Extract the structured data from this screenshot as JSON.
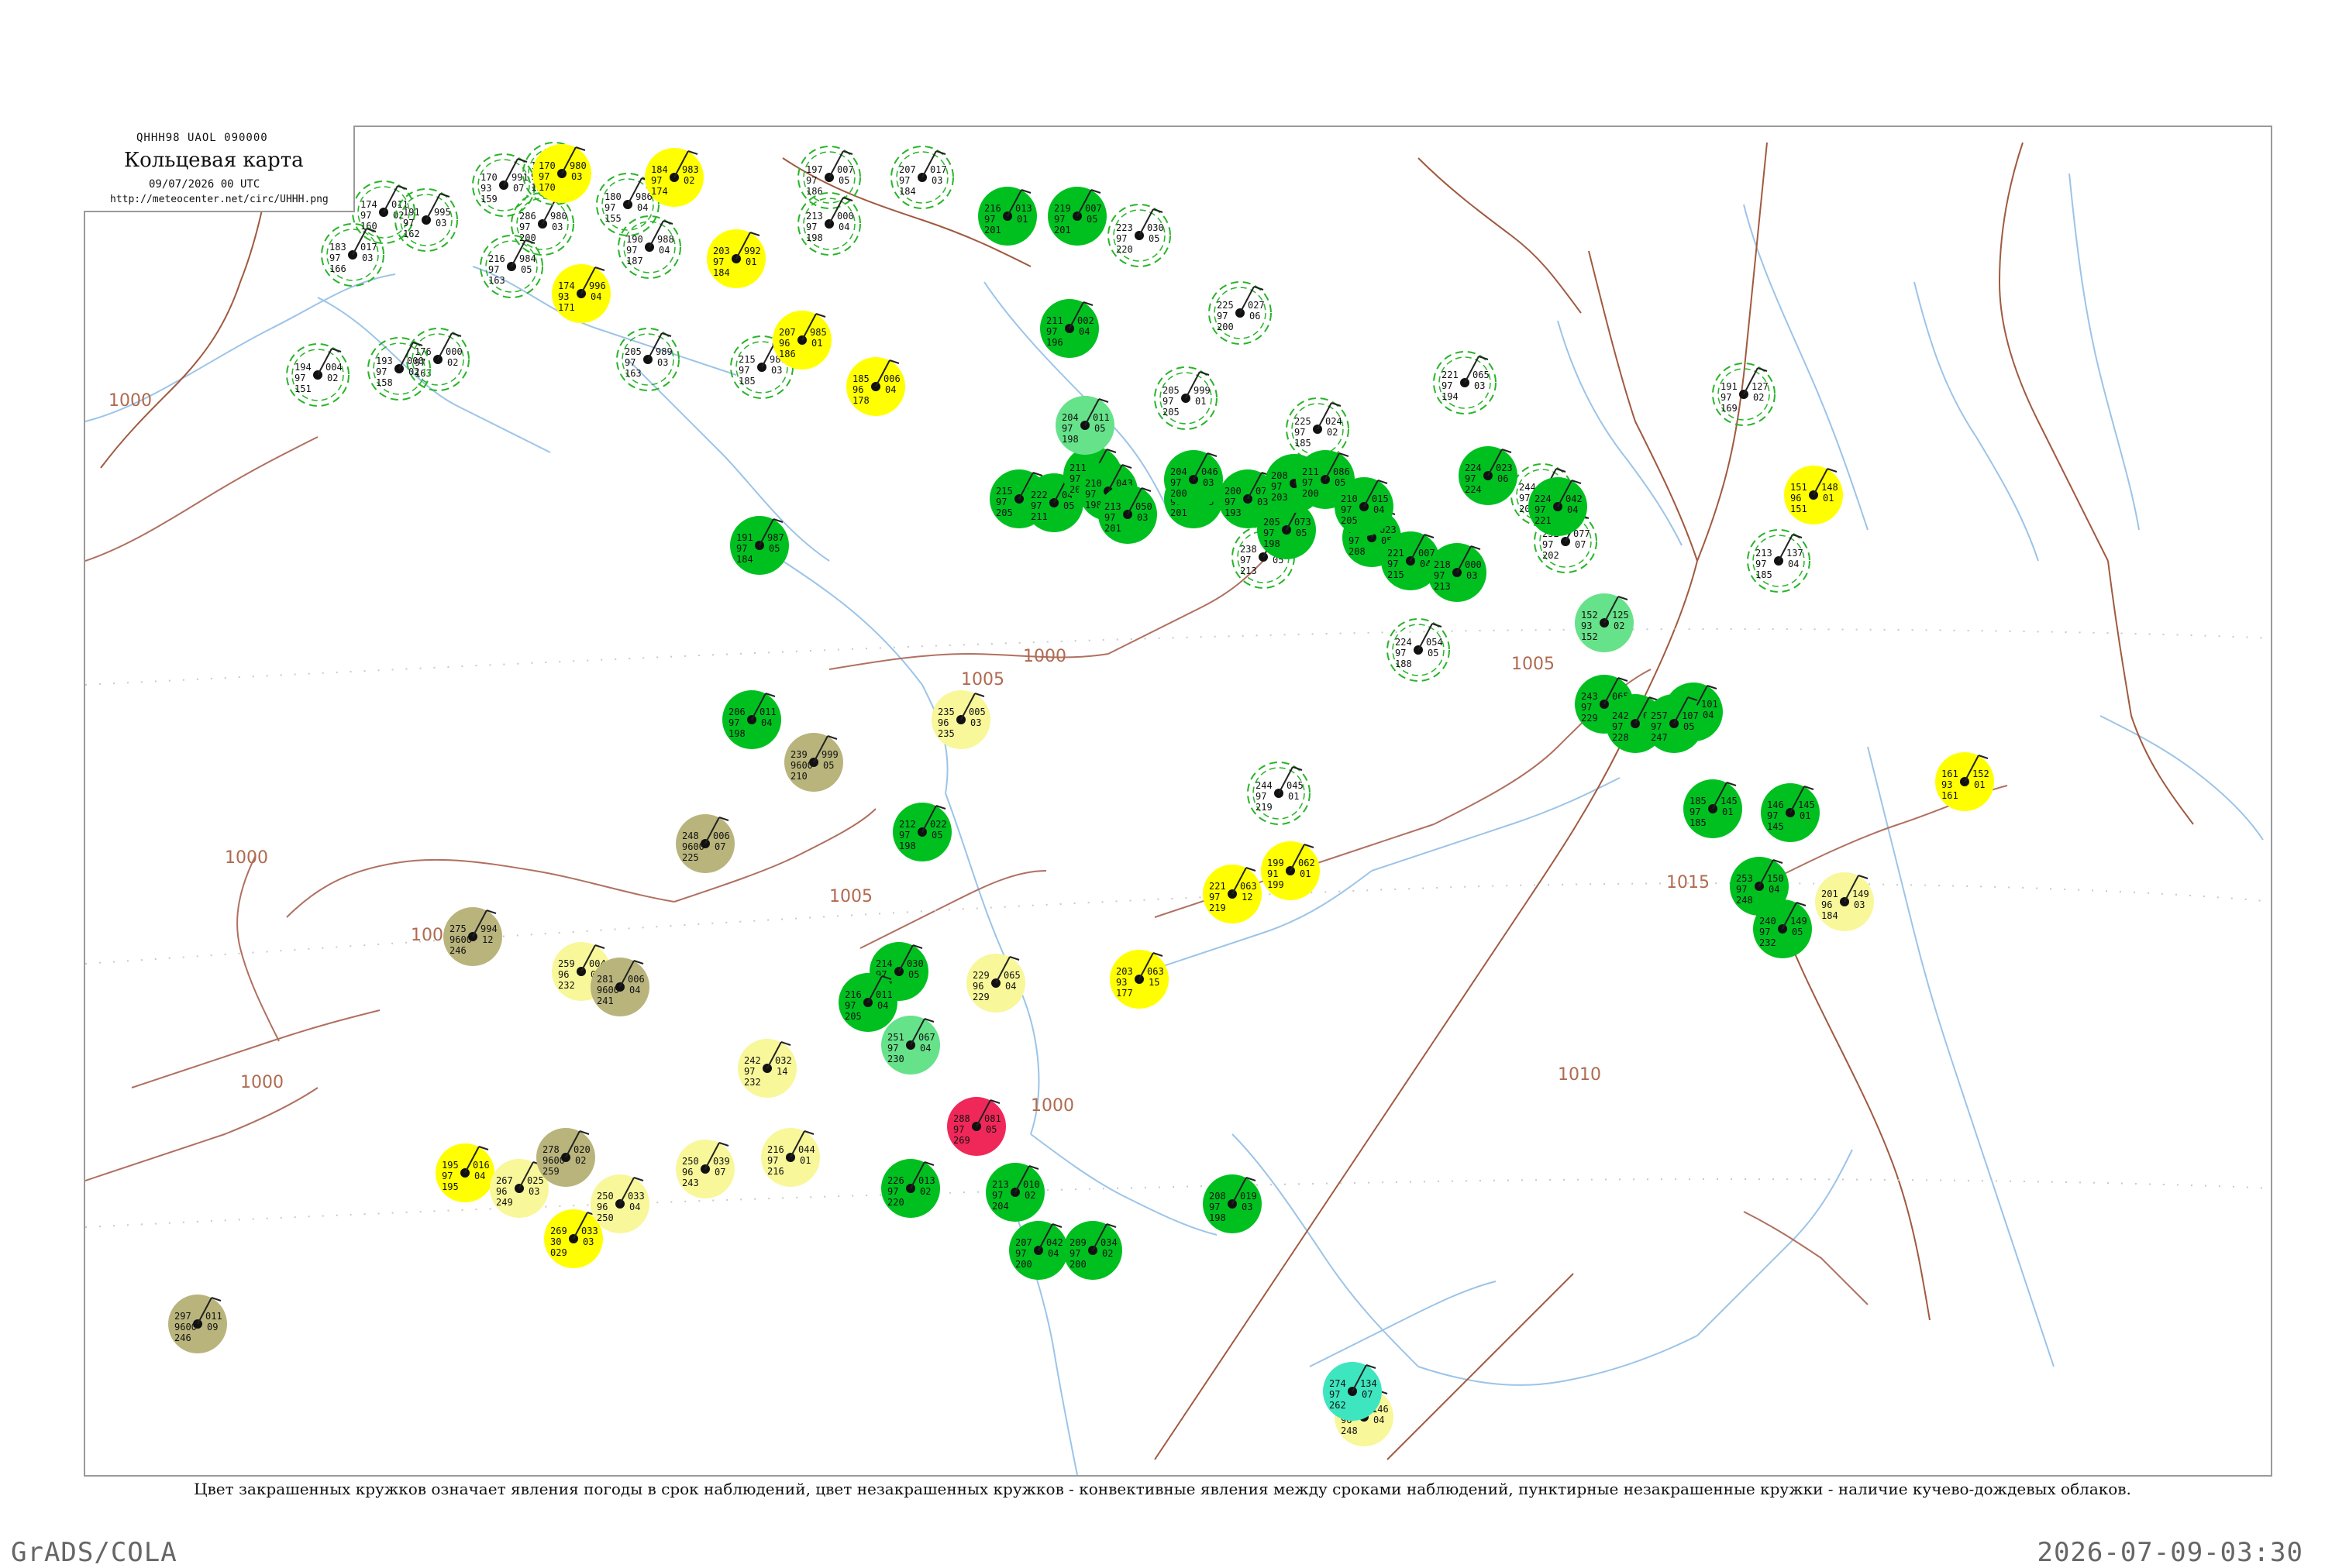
{
  "header": {
    "codes": "QHHH98  UAOL  090000",
    "title": "Кольцевая карта",
    "datetime": "09/07/2026 00 UTC",
    "url": "http://meteocenter.net/circ/UHHH.png"
  },
  "caption": "Цвет закрашенных кружков означает явления погоды в срок наблюдений, цвет незакрашенных кружков - конвективные явления между сроками наблюдений, пунктирные незакрашенные кружки - наличие кучево-дождевых облаков.",
  "footer": {
    "left": "GrADS/COLA",
    "right": "2026-07-09-03:30"
  },
  "colors": {
    "rain_green": "#00c020",
    "shower_green": "#00b428",
    "light_green": "#66e28a",
    "cyan": "#3ee6c0",
    "yellow": "#ffff00",
    "pale_yellow": "#f8f79a",
    "olive": "#b8b47c",
    "thunder_red": "#f0285a",
    "outline_green": "#28b428",
    "isobar": "#a05a40",
    "river": "#9cc4e8"
  },
  "isobars": [
    "1000",
    "1000",
    "1000",
    "1000",
    "1005",
    "1005",
    "1005",
    "1010",
    "1015",
    "1000",
    "1000"
  ],
  "stations": [
    {
      "kind": "outline",
      "a": "170",
      "b": "93",
      "c": "159",
      "d": "991",
      "e": "07"
    },
    {
      "kind": "outline",
      "a": "286",
      "b": "97",
      "c": "200",
      "d": "980",
      "e": "03"
    },
    {
      "kind": "outline",
      "a": "180",
      "b": "97",
      "c": "155",
      "d": "986",
      "e": "04"
    },
    {
      "kind": "outline",
      "a": "170",
      "b": "97",
      "c": "150",
      "d": "980",
      "e": "06"
    },
    {
      "kind": "outline",
      "a": "174",
      "b": "97",
      "c": "160",
      "d": "011",
      "e": "02"
    },
    {
      "kind": "outline",
      "a": "191",
      "b": "97",
      "c": "162",
      "d": "995",
      "e": "03"
    },
    {
      "kind": "outline",
      "a": "183",
      "b": "97",
      "c": "166",
      "d": "017",
      "e": "03"
    },
    {
      "kind": "outline",
      "a": "190",
      "b": "97",
      "c": "187",
      "d": "988",
      "e": "04"
    },
    {
      "kind": "outline",
      "a": "216",
      "b": "97",
      "c": "163",
      "d": "984",
      "e": "05"
    },
    {
      "kind": "outline",
      "a": "176",
      "b": "97",
      "c": "163",
      "d": "000",
      "e": "02"
    },
    {
      "kind": "outline",
      "a": "205",
      "b": "97",
      "c": "163",
      "d": "989",
      "e": "03"
    },
    {
      "kind": "outline",
      "a": "194",
      "b": "97",
      "c": "151",
      "d": "004",
      "e": "02"
    },
    {
      "kind": "outline",
      "a": "193",
      "b": "97",
      "c": "158",
      "d": "000",
      "e": "02"
    },
    {
      "kind": "outline",
      "a": "215",
      "b": "97",
      "c": "185",
      "d": "987",
      "e": "03"
    },
    {
      "kind": "outline",
      "a": "197",
      "b": "97",
      "c": "186",
      "d": "007",
      "e": "05"
    },
    {
      "kind": "outline",
      "a": "213",
      "b": "97",
      "c": "198",
      "d": "000",
      "e": "04"
    },
    {
      "kind": "outline",
      "a": "207",
      "b": "97",
      "c": "184",
      "d": "017",
      "e": "03"
    },
    {
      "kind": "outline",
      "a": "223",
      "b": "97",
      "c": "220",
      "d": "030",
      "e": "05"
    },
    {
      "kind": "outline",
      "a": "225",
      "b": "97",
      "c": "200",
      "d": "027",
      "e": "06"
    },
    {
      "kind": "outline",
      "a": "205",
      "b": "97",
      "c": "205",
      "d": "999",
      "e": "01"
    },
    {
      "kind": "outline",
      "a": "238",
      "b": "97",
      "c": "213",
      "d": "007",
      "e": "05"
    },
    {
      "kind": "outline",
      "a": "224",
      "b": "97",
      "c": "188",
      "d": "054",
      "e": "05"
    },
    {
      "kind": "outline",
      "a": "221",
      "b": "97",
      "c": "194",
      "d": "065",
      "e": "03"
    },
    {
      "kind": "outline",
      "a": "244",
      "b": "97",
      "c": "205",
      "d": "060",
      "e": "01"
    },
    {
      "kind": "outline",
      "a": "232",
      "b": "97",
      "c": "202",
      "d": "077",
      "e": "07"
    },
    {
      "kind": "outline",
      "a": "191",
      "b": "97",
      "c": "169",
      "d": "127",
      "e": "02"
    },
    {
      "kind": "outline",
      "a": "213",
      "b": "97",
      "c": "185",
      "d": "137",
      "e": "04"
    },
    {
      "kind": "outline",
      "a": "244",
      "b": "97",
      "c": "219",
      "d": "045",
      "e": "01"
    },
    {
      "kind": "outline",
      "a": "225",
      "b": "97",
      "c": "185",
      "d": "024",
      "e": "02"
    },
    {
      "kind": "yellow",
      "a": "170",
      "b": "97",
      "c": "170",
      "d": "980",
      "e": "03"
    },
    {
      "kind": "yellow",
      "a": "184",
      "b": "97",
      "c": "174",
      "d": "983",
      "e": "02"
    },
    {
      "kind": "yellow",
      "a": "203",
      "b": "97",
      "c": "184",
      "d": "992",
      "e": "01"
    },
    {
      "kind": "yellow",
      "a": "174",
      "b": "93",
      "c": "171",
      "d": "996",
      "e": "04"
    },
    {
      "kind": "yellow",
      "a": "207",
      "b": "96",
      "c": "186",
      "d": "985",
      "e": "01"
    },
    {
      "kind": "yellow",
      "a": "185",
      "b": "96",
      "c": "178",
      "d": "006",
      "e": "04"
    },
    {
      "kind": "yellow",
      "a": "221",
      "b": "97",
      "c": "219",
      "d": "063",
      "e": "12"
    },
    {
      "kind": "yellow",
      "a": "199",
      "b": "91",
      "c": "199",
      "d": "062",
      "e": "01"
    },
    {
      "kind": "yellow",
      "a": "203",
      "b": "93",
      "c": "177",
      "d": "063",
      "e": "15"
    },
    {
      "kind": "yellow",
      "a": "151",
      "b": "96",
      "c": "151",
      "d": "148",
      "e": "01"
    },
    {
      "kind": "yellow",
      "a": "161",
      "b": "93",
      "c": "161",
      "d": "152",
      "e": "01"
    },
    {
      "kind": "yellow",
      "a": "195",
      "b": "97",
      "c": "195",
      "d": "016",
      "e": "04"
    },
    {
      "kind": "yellow",
      "a": "269",
      "b": "30",
      "c": "029",
      "d": "033",
      "e": "03"
    },
    {
      "kind": "pale",
      "a": "235",
      "b": "96",
      "c": "235",
      "d": "005",
      "e": "03"
    },
    {
      "kind": "pale",
      "a": "229",
      "b": "96",
      "c": "229",
      "d": "065",
      "e": "04"
    },
    {
      "kind": "pale",
      "a": "242",
      "b": "97",
      "c": "232",
      "d": "032",
      "e": "14"
    },
    {
      "kind": "pale",
      "a": "259",
      "b": "96",
      "c": "232",
      "d": "004",
      "e": "05"
    },
    {
      "kind": "pale",
      "a": "250",
      "b": "96",
      "c": "243",
      "d": "039",
      "e": "07"
    },
    {
      "kind": "pale",
      "a": "216",
      "b": "97",
      "c": "216",
      "d": "044",
      "e": "01"
    },
    {
      "kind": "pale",
      "a": "267",
      "b": "96",
      "c": "249",
      "d": "025",
      "e": "03"
    },
    {
      "kind": "pale",
      "a": "250",
      "b": "96",
      "c": "250",
      "d": "033",
      "e": "04"
    },
    {
      "kind": "pale",
      "a": "201",
      "b": "96",
      "c": "184",
      "d": "149",
      "e": "03"
    },
    {
      "kind": "pale",
      "a": "251",
      "b": "96",
      "c": "248",
      "d": "146",
      "e": "04"
    },
    {
      "kind": "olive",
      "a": "239",
      "b": "9600",
      "c": "210",
      "d": "999",
      "e": "05"
    },
    {
      "kind": "olive",
      "a": "248",
      "b": "9600",
      "c": "225",
      "d": "006",
      "e": "07"
    },
    {
      "kind": "olive",
      "a": "275",
      "b": "9600",
      "c": "246",
      "d": "994",
      "e": "12"
    },
    {
      "kind": "olive",
      "a": "281",
      "b": "9600",
      "c": "241",
      "d": "006",
      "e": "04"
    },
    {
      "kind": "olive",
      "a": "278",
      "b": "9600",
      "c": "259",
      "d": "020",
      "e": "02"
    },
    {
      "kind": "olive",
      "a": "297",
      "b": "9600",
      "c": "246",
      "d": "011",
      "e": "09"
    },
    {
      "kind": "green",
      "a": "216",
      "b": "97",
      "c": "201",
      "d": "013",
      "e": "01"
    },
    {
      "kind": "green",
      "a": "219",
      "b": "97",
      "c": "201",
      "d": "007",
      "e": "05"
    },
    {
      "kind": "green",
      "a": "211",
      "b": "97",
      "c": "196",
      "d": "002",
      "e": "04"
    },
    {
      "kind": "green",
      "a": "191",
      "b": "97",
      "c": "184",
      "d": "987",
      "e": "05"
    },
    {
      "kind": "green",
      "a": "206",
      "b": "97",
      "c": "198",
      "d": "011",
      "e": "04"
    },
    {
      "kind": "green",
      "a": "212",
      "b": "97",
      "c": "198",
      "d": "022",
      "e": "05"
    },
    {
      "kind": "green",
      "a": "214",
      "b": "97",
      "c": "197",
      "d": "030",
      "e": "05"
    },
    {
      "kind": "green",
      "a": "216",
      "b": "97",
      "c": "205",
      "d": "011",
      "e": "04"
    },
    {
      "kind": "green",
      "a": "226",
      "b": "97",
      "c": "220",
      "d": "013",
      "e": "02"
    },
    {
      "kind": "green",
      "a": "213",
      "b": "97",
      "c": "204",
      "d": "010",
      "e": "02"
    },
    {
      "kind": "green",
      "a": "207",
      "b": "97",
      "c": "200",
      "d": "042",
      "e": "04"
    },
    {
      "kind": "green",
      "a": "209",
      "b": "97",
      "c": "200",
      "d": "034",
      "e": "02"
    },
    {
      "kind": "green",
      "a": "208",
      "b": "97",
      "c": "198",
      "d": "019",
      "e": "03"
    },
    {
      "kind": "green",
      "a": "215",
      "b": "97",
      "c": "205",
      "d": "028",
      "e": "03"
    },
    {
      "kind": "green",
      "a": "222",
      "b": "97",
      "c": "211",
      "d": "046",
      "e": "05"
    },
    {
      "kind": "green",
      "a": "211",
      "b": "97",
      "c": "204",
      "d": "041",
      "e": "04"
    },
    {
      "kind": "green",
      "a": "210",
      "b": "97",
      "c": "198",
      "d": "043",
      "e": "03"
    },
    {
      "kind": "green",
      "a": "213",
      "b": "97",
      "c": "201",
      "d": "050",
      "e": "03"
    },
    {
      "kind": "green",
      "a": "213",
      "b": "97",
      "c": "201",
      "d": "039",
      "e": "05"
    },
    {
      "kind": "green",
      "a": "204",
      "b": "97",
      "c": "200",
      "d": "046",
      "e": "03"
    },
    {
      "kind": "green",
      "a": "200",
      "b": "97",
      "c": "193",
      "d": "070",
      "e": "03"
    },
    {
      "kind": "green",
      "a": "205",
      "b": "97",
      "c": "198",
      "d": "073",
      "e": "05"
    },
    {
      "kind": "green",
      "a": "208",
      "b": "97",
      "c": "203",
      "d": "093",
      "e": "06"
    },
    {
      "kind": "green",
      "a": "211",
      "b": "97",
      "c": "200",
      "d": "086",
      "e": "05"
    },
    {
      "kind": "green",
      "a": "215",
      "b": "97",
      "c": "208",
      "d": "023",
      "e": "05"
    },
    {
      "kind": "green",
      "a": "210",
      "b": "97",
      "c": "205",
      "d": "015",
      "e": "04"
    },
    {
      "kind": "green",
      "a": "221",
      "b": "97",
      "c": "215",
      "d": "007",
      "e": "04"
    },
    {
      "kind": "green",
      "a": "218",
      "b": "97",
      "c": "213",
      "d": "000",
      "e": "03"
    },
    {
      "kind": "green",
      "a": "224",
      "b": "97",
      "c": "224",
      "d": "023",
      "e": "06"
    },
    {
      "kind": "green",
      "a": "224",
      "b": "97",
      "c": "221",
      "d": "042",
      "e": "04"
    },
    {
      "kind": "green",
      "a": "185",
      "b": "97",
      "c": "185",
      "d": "145",
      "e": "01"
    },
    {
      "kind": "green",
      "a": "146",
      "b": "97",
      "c": "145",
      "d": "145",
      "e": "01"
    },
    {
      "kind": "green",
      "a": "243",
      "b": "97",
      "c": "229",
      "d": "065",
      "e": "05"
    },
    {
      "kind": "green",
      "a": "242",
      "b": "97",
      "c": "228",
      "d": "072",
      "e": "06"
    },
    {
      "kind": "green",
      "a": "258",
      "b": "97",
      "c": "245",
      "d": "101",
      "e": "04"
    },
    {
      "kind": "green",
      "a": "257",
      "b": "97",
      "c": "247",
      "d": "107",
      "e": "05"
    },
    {
      "kind": "green",
      "a": "253",
      "b": "97",
      "c": "248",
      "d": "150",
      "e": "04"
    },
    {
      "kind": "green",
      "a": "240",
      "b": "97",
      "c": "232",
      "d": "149",
      "e": "05"
    },
    {
      "kind": "lightgreen",
      "a": "204",
      "b": "97",
      "c": "198",
      "d": "011",
      "e": "05"
    },
    {
      "kind": "lightgreen",
      "a": "152",
      "b": "93",
      "c": "152",
      "d": "125",
      "e": "02"
    },
    {
      "kind": "lightgreen",
      "a": "251",
      "b": "97",
      "c": "230",
      "d": "067",
      "e": "04"
    },
    {
      "kind": "cyan",
      "a": "274",
      "b": "97",
      "c": "262",
      "d": "134",
      "e": "07"
    },
    {
      "kind": "red",
      "a": "288",
      "b": "97",
      "c": "269",
      "d": "081",
      "e": "05"
    }
  ]
}
